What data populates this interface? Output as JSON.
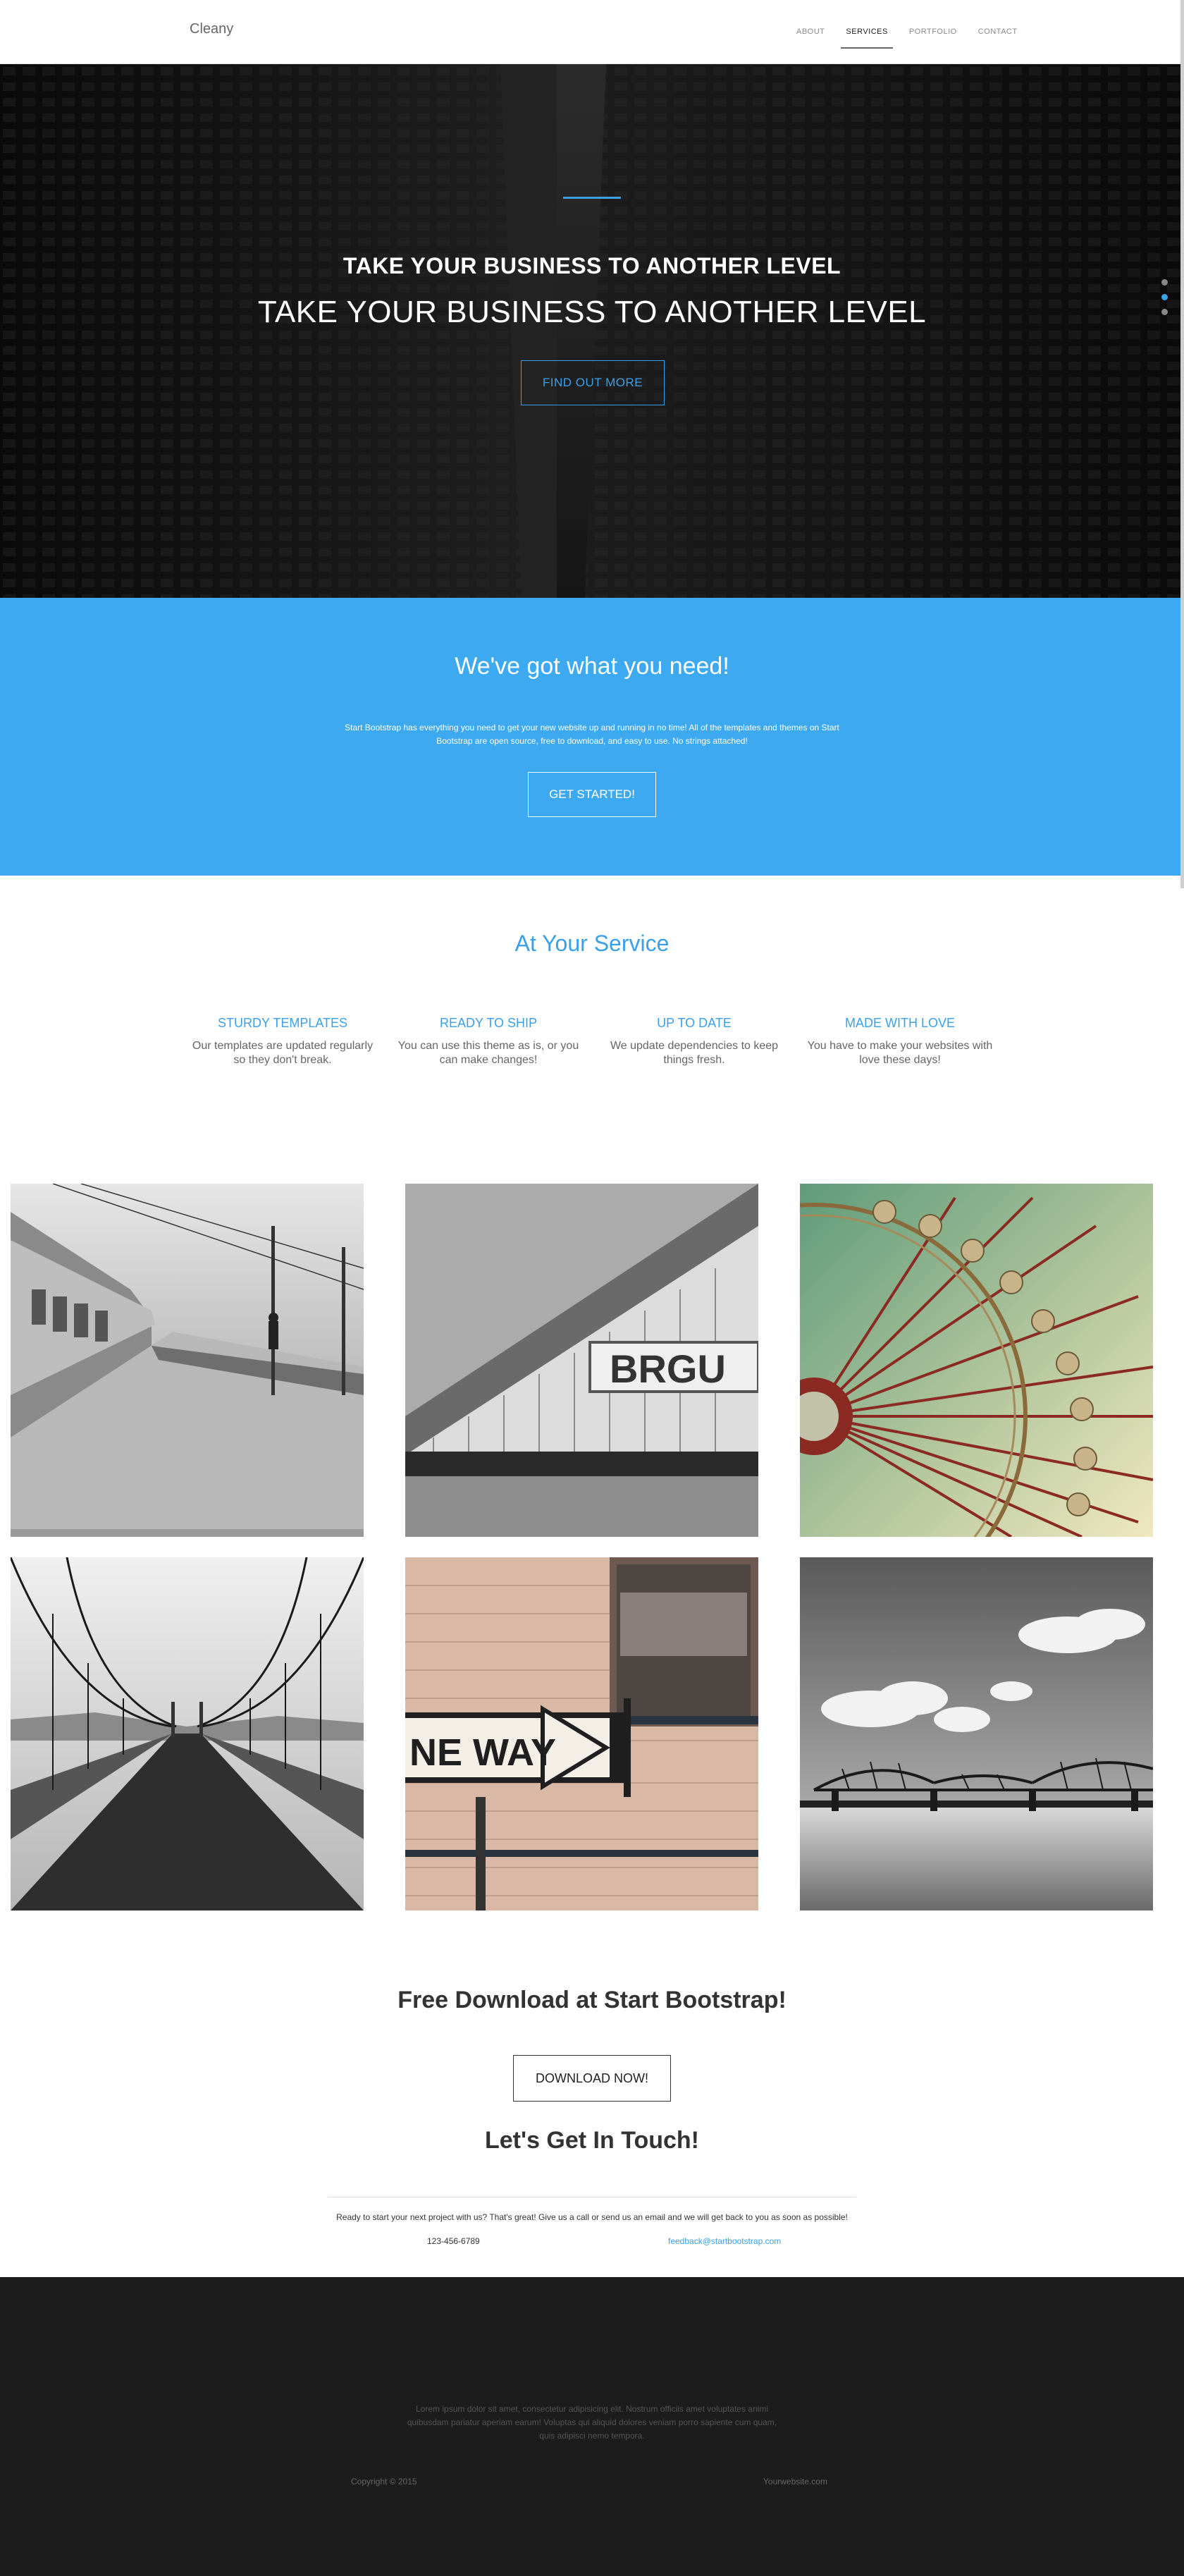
{
  "nav": {
    "brand": "Cleany",
    "items": [
      {
        "label": "ABOUT"
      },
      {
        "label": "SERVICES",
        "active": true
      },
      {
        "label": "PORTFOLIO"
      },
      {
        "label": "CONTACT"
      }
    ]
  },
  "hero": {
    "title_bold": "TAKE YOUR BUSINESS TO ANOTHER LEVEL",
    "title_light": "TAKE YOUR BUSINESS TO ANOTHER LEVEL",
    "button": "FIND OUT MORE",
    "slide_dots": 3,
    "active_dot": 2
  },
  "about": {
    "heading": "We've got what you need!",
    "text": "Start Bootstrap has everything you need to get your new website up and running in no time! All of the templates and themes on Start Bootstrap are open source, free to download, and easy to use. No strings attached!",
    "button": "GET STARTED!"
  },
  "services": {
    "heading": "At Your Service",
    "items": [
      {
        "title": "STURDY TEMPLATES",
        "text": "Our templates are updated regularly so they don't break."
      },
      {
        "title": "READY TO SHIP",
        "text": "You can use this theme as is, or you can make changes!"
      },
      {
        "title": "UP TO DATE",
        "text": "We update dependencies to keep things fresh."
      },
      {
        "title": "MADE WITH LOVE",
        "text": "You have to make your websites with love these days!"
      }
    ]
  },
  "portfolio": {
    "images": [
      "train-platform",
      "wooden-building-sign",
      "ferris-wheel",
      "suspension-bridge",
      "one-way-sign",
      "river-bridge"
    ],
    "sign_text": "BRGU",
    "one_way_text": "NE WAY"
  },
  "download": {
    "heading": "Free Download at Start Bootstrap!",
    "button": "DOWNLOAD NOW!"
  },
  "contact": {
    "heading": "Let's Get In Touch!",
    "text": "Ready to start your next project with us? That's great! Give us a call or send us an email and we will get back to you as soon as possible!",
    "phone": "123-456-6789",
    "email": "feedback@startbootstrap.com"
  },
  "footer": {
    "text": "Lorem ipsum dolor sit amet, consectetur adipisicing elit. Nostrum officiis amet voluptates animi quibusdam pariatur aperiam earum! Voluptas qui aliquid dolores veniam porro sapiente cum quam, quis adipisci nemo tempora.",
    "copyright": "Copyright © 2015",
    "site": "Yourwebsite.com"
  },
  "colors": {
    "accent": "#3aa0e8",
    "blue_section": "#3ca9f0",
    "footer_bg": "#1c1c1c"
  }
}
